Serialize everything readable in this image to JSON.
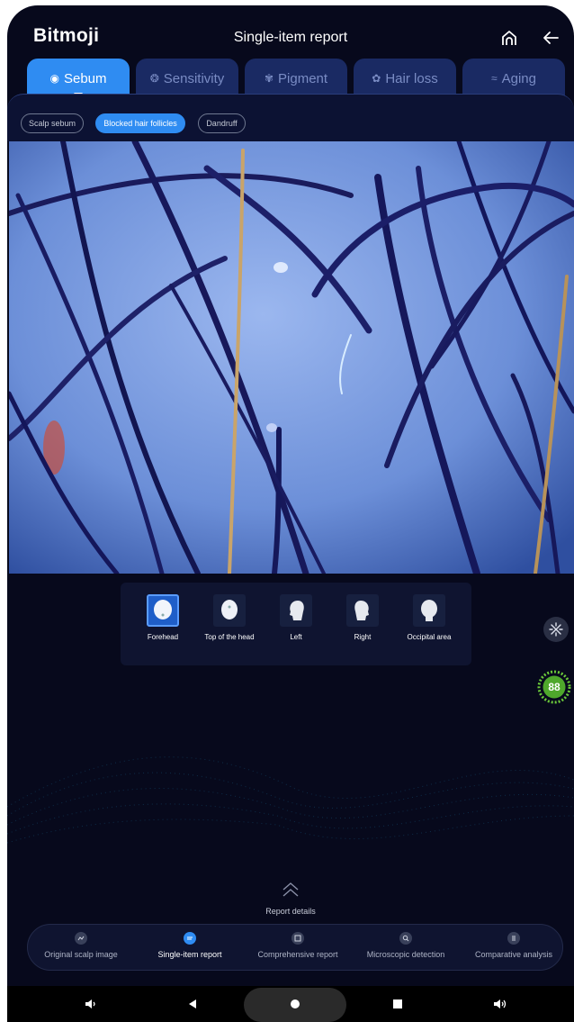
{
  "app": {
    "logo": "Bitmoji",
    "title": "Single-item report"
  },
  "header": {
    "home_icon": "home-icon",
    "back_icon": "arrow-left-icon"
  },
  "tabs": [
    {
      "label": "Sebum",
      "icon": "sebum-icon",
      "active": true
    },
    {
      "label": "Sensitivity",
      "icon": "sensitivity-icon",
      "active": false
    },
    {
      "label": "Pigment",
      "icon": "pigment-icon",
      "active": false
    },
    {
      "label": "Hair loss",
      "icon": "hair-loss-icon",
      "active": false
    },
    {
      "label": "Aging",
      "icon": "aging-icon",
      "active": false
    }
  ],
  "subtabs": [
    {
      "label": "Scalp sebum",
      "active": false
    },
    {
      "label": "Blocked hair follicles",
      "active": true
    },
    {
      "label": "Dandruff",
      "active": false
    }
  ],
  "positions": [
    {
      "label": "Forehead",
      "active": true
    },
    {
      "label": "Top of the head",
      "active": false
    },
    {
      "label": "Left",
      "active": false
    },
    {
      "label": "Right",
      "active": false
    },
    {
      "label": "Occipital area",
      "active": false
    }
  ],
  "score": {
    "value": "88",
    "color": "#6bc93a"
  },
  "report_details": {
    "label": "Report details"
  },
  "bottom_nav": [
    {
      "label": "Original scalp image",
      "icon": "image-icon",
      "active": false
    },
    {
      "label": "Single-item report",
      "icon": "report-icon",
      "active": true
    },
    {
      "label": "Comprehensive report",
      "icon": "comprehensive-icon",
      "active": false
    },
    {
      "label": "Microscopic detection",
      "icon": "microscope-icon",
      "active": false
    },
    {
      "label": "Comparative analysis",
      "icon": "compare-icon",
      "active": false
    }
  ],
  "system_bar": [
    "volume-down-icon",
    "back-triangle-icon",
    "home-circle-icon",
    "recents-square-icon",
    "volume-up-icon"
  ],
  "colors": {
    "accent": "#2f8cf2",
    "background": "#07091c",
    "tab_inactive": "#1a2a63"
  }
}
